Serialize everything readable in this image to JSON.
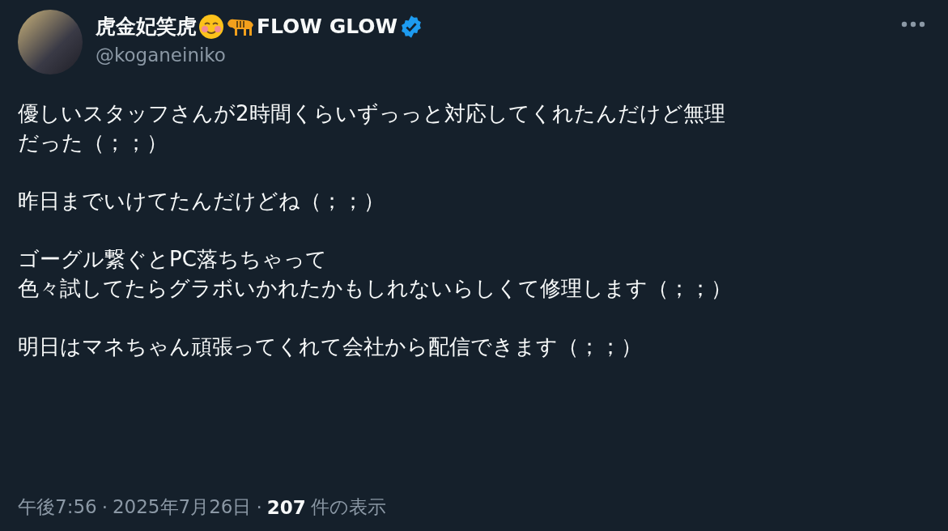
{
  "author": {
    "name": "虎金妃笑虎",
    "name_suffix": "FLOW GLOW",
    "verified": true,
    "handle": "@koganeiniko"
  },
  "body": [
    [
      "優しいスタッフさんが2時間くらいずっっと対応してくれたんだけど無理",
      "だった（；；）"
    ],
    [
      "昨日までいけてたんだけどね（；；）"
    ],
    [
      "ゴーグル繋ぐとPC落ちちゃって",
      "色々試してたらグラボいかれたかもしれないらしくて修理します（；；）"
    ],
    [
      "明日はマネちゃん頑張ってくれて会社から配信できます（；；）"
    ]
  ],
  "meta": {
    "time": "午後7:56",
    "separator_1": "·",
    "date": "2025年7月26日",
    "separator_2": "·",
    "views": "207",
    "views_label": "件の表示"
  }
}
